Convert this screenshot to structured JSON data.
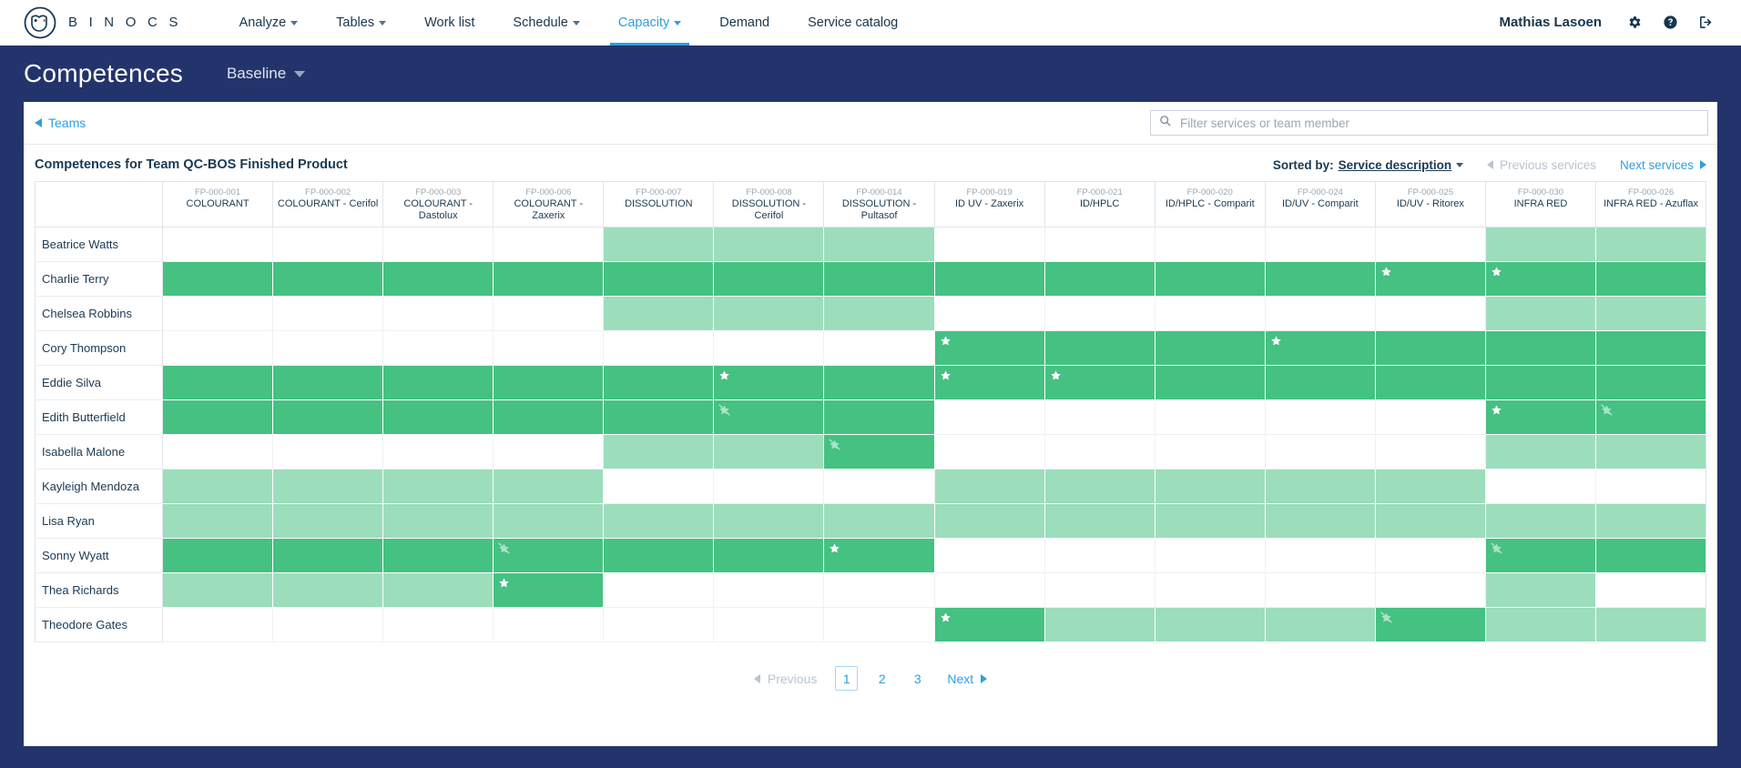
{
  "topnav": {
    "brand": "B I N O C S",
    "items": [
      {
        "label": "Analyze",
        "caret": true,
        "active": false
      },
      {
        "label": "Tables",
        "caret": true,
        "active": false
      },
      {
        "label": "Work list",
        "caret": false,
        "active": false
      },
      {
        "label": "Schedule",
        "caret": true,
        "active": false
      },
      {
        "label": "Capacity",
        "caret": true,
        "active": true
      },
      {
        "label": "Demand",
        "caret": false,
        "active": false
      },
      {
        "label": "Service catalog",
        "caret": false,
        "active": false
      }
    ],
    "user": "Mathias Lasoen",
    "icons": [
      "gear-icon",
      "help-icon",
      "logout-icon"
    ]
  },
  "titlebar": {
    "title": "Competences",
    "scenario": "Baseline"
  },
  "toolbar": {
    "back_label": "Teams",
    "search_placeholder": "Filter services or team member",
    "search_value": ""
  },
  "table": {
    "heading": "Competences for Team QC-BOS Finished Product",
    "sorted_by_label": "Sorted by:",
    "sorted_by_value": "Service description",
    "previous_services": "Previous services",
    "next_services": "Next services",
    "columns": [
      {
        "code": "FP-000-001",
        "name": "COLOURANT"
      },
      {
        "code": "FP-000-002",
        "name": "COLOURANT - Cerifol"
      },
      {
        "code": "FP-000-003",
        "name": "COLOURANT - Dastolux"
      },
      {
        "code": "FP-000-006",
        "name": "COLOURANT - Zaxerix"
      },
      {
        "code": "FP-000-007",
        "name": "DISSOLUTION"
      },
      {
        "code": "FP-000-008",
        "name": "DISSOLUTION - Cerifol"
      },
      {
        "code": "FP-000-014",
        "name": "DISSOLUTION - Pultasof"
      },
      {
        "code": "FP-000-019",
        "name": "ID UV - Zaxerix"
      },
      {
        "code": "FP-000-021",
        "name": "ID/HPLC"
      },
      {
        "code": "FP-000-020",
        "name": "ID/HPLC - Comparit"
      },
      {
        "code": "FP-000-024",
        "name": "ID/UV - Comparit"
      },
      {
        "code": "FP-000-025",
        "name": "ID/UV - Ritorex"
      },
      {
        "code": "FP-000-030",
        "name": "INFRA RED"
      },
      {
        "code": "FP-000-026",
        "name": "INFRA RED - Azuflax"
      }
    ],
    "rows": [
      {
        "name": "Beatrice Watts",
        "cells": [
          "none",
          "none",
          "none",
          "none",
          "light",
          "light",
          "light",
          "none",
          "none",
          "none",
          "none",
          "none",
          "light",
          "light"
        ],
        "stars": {}
      },
      {
        "name": "Charlie Terry",
        "cells": [
          "dark",
          "dark",
          "dark",
          "dark",
          "dark",
          "dark",
          "dark",
          "dark",
          "dark",
          "dark",
          "dark",
          "dark",
          "dark",
          "dark"
        ],
        "stars": {
          "11": "star",
          "12": "star"
        }
      },
      {
        "name": "Chelsea Robbins",
        "cells": [
          "none",
          "none",
          "none",
          "none",
          "light",
          "light",
          "light",
          "none",
          "none",
          "none",
          "none",
          "none",
          "light",
          "light"
        ],
        "stars": {}
      },
      {
        "name": "Cory Thompson",
        "cells": [
          "none",
          "none",
          "none",
          "none",
          "none",
          "none",
          "none",
          "dark",
          "dark",
          "dark",
          "dark",
          "dark",
          "dark",
          "dark"
        ],
        "stars": {
          "7": "star",
          "10": "star"
        }
      },
      {
        "name": "Eddie Silva",
        "cells": [
          "dark",
          "dark",
          "dark",
          "dark",
          "dark",
          "dark",
          "dark",
          "dark",
          "dark",
          "dark",
          "dark",
          "dark",
          "dark",
          "dark"
        ],
        "stars": {
          "5": "star",
          "7": "star",
          "8": "star"
        }
      },
      {
        "name": "Edith Butterfield",
        "cells": [
          "dark",
          "dark",
          "dark",
          "dark",
          "dark",
          "dark",
          "dark",
          "none",
          "none",
          "none",
          "none",
          "none",
          "dark",
          "dark"
        ],
        "stars": {
          "5": "crossed",
          "12": "star",
          "13": "crossed"
        }
      },
      {
        "name": "Isabella Malone",
        "cells": [
          "none",
          "none",
          "none",
          "none",
          "light",
          "light",
          "dark",
          "none",
          "none",
          "none",
          "none",
          "none",
          "light",
          "light"
        ],
        "stars": {
          "6": "crossed"
        }
      },
      {
        "name": "Kayleigh Mendoza",
        "cells": [
          "light",
          "light",
          "light",
          "light",
          "none",
          "none",
          "none",
          "light",
          "light",
          "light",
          "light",
          "light",
          "none",
          "none"
        ],
        "stars": {}
      },
      {
        "name": "Lisa Ryan",
        "cells": [
          "light",
          "light",
          "light",
          "light",
          "light",
          "light",
          "light",
          "light",
          "light",
          "light",
          "light",
          "light",
          "light",
          "light"
        ],
        "stars": {}
      },
      {
        "name": "Sonny Wyatt",
        "cells": [
          "dark",
          "dark",
          "dark",
          "dark",
          "dark",
          "dark",
          "dark",
          "none",
          "none",
          "none",
          "none",
          "none",
          "dark",
          "dark"
        ],
        "stars": {
          "3": "crossed",
          "6": "star",
          "12": "crossed"
        }
      },
      {
        "name": "Thea Richards",
        "cells": [
          "light",
          "light",
          "light",
          "dark",
          "none",
          "none",
          "none",
          "none",
          "none",
          "none",
          "none",
          "none",
          "light",
          "none"
        ],
        "stars": {
          "3": "star"
        }
      },
      {
        "name": "Theodore Gates",
        "cells": [
          "none",
          "none",
          "none",
          "none",
          "none",
          "none",
          "none",
          "dark",
          "light",
          "light",
          "light",
          "dark",
          "light",
          "light"
        ],
        "stars": {
          "7": "star",
          "11": "crossed"
        }
      }
    ]
  },
  "pagination": {
    "previous": "Previous",
    "pages": [
      "1",
      "2",
      "3"
    ],
    "current": "1",
    "next": "Next"
  },
  "colors": {
    "brand_navy": "#22346b",
    "accent_blue": "#2e9fe0",
    "level_light": "#9cddbc",
    "level_dark": "#45c182"
  }
}
